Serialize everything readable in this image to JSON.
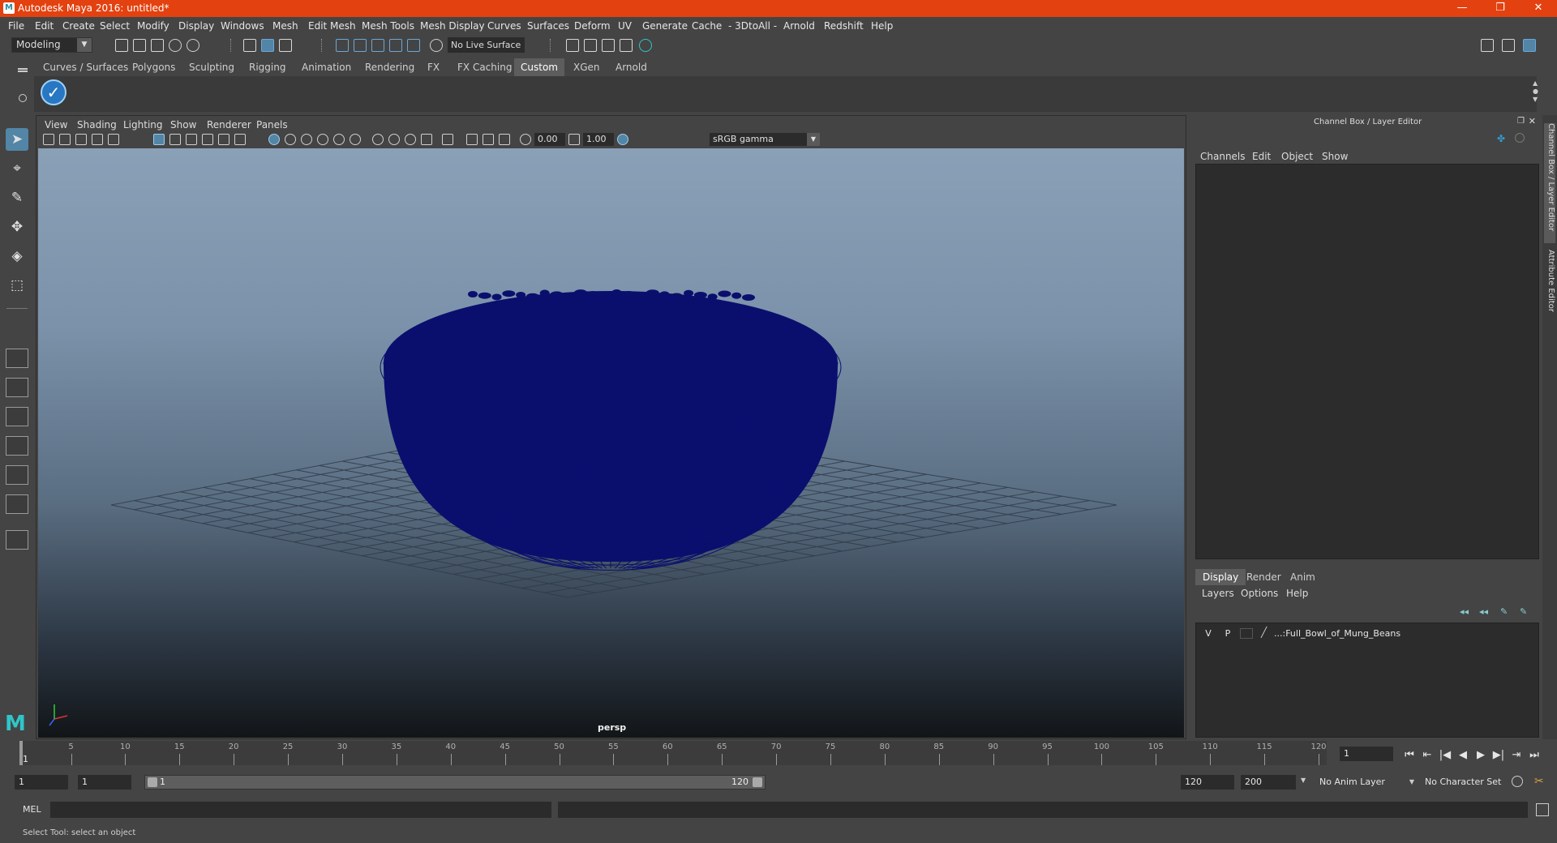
{
  "window": {
    "title": "Autodesk Maya 2016: untitled*",
    "app_icon": "M",
    "minimize": "—",
    "maximize": "❐",
    "close": "✕"
  },
  "menubar": [
    "File",
    "Edit",
    "Create",
    "Select",
    "Modify",
    "Display",
    "Windows",
    "Mesh",
    "Edit Mesh",
    "Mesh Tools",
    "Mesh Display",
    "Curves",
    "Surfaces",
    "Deform",
    "UV",
    "Generate",
    "Cache",
    "- 3DtoAll -",
    "Arnold",
    "Redshift",
    "Help"
  ],
  "statusline": {
    "mode": "Modeling",
    "live_surface": "No Live Surface"
  },
  "shelf": {
    "tabs": [
      "Curves / Surfaces",
      "Polygons",
      "Sculpting",
      "Rigging",
      "Animation",
      "Rendering",
      "FX",
      "FX Caching",
      "Custom",
      "XGen",
      "Arnold"
    ],
    "active_tab": "Custom",
    "button_glyph": "✓"
  },
  "viewport": {
    "menu": [
      "View",
      "Shading",
      "Lighting",
      "Show",
      "Renderer",
      "Panels"
    ],
    "exposure": "0.00",
    "gamma": "1.00",
    "color_space": "sRGB gamma",
    "camera": "persp"
  },
  "channel_box": {
    "title": "Channel Box / Layer Editor",
    "menu": [
      "Channels",
      "Edit",
      "Object",
      "Show"
    ]
  },
  "layer_editor": {
    "tabs": [
      "Display",
      "Render",
      "Anim"
    ],
    "active_tab": "Display",
    "menu": [
      "Layers",
      "Options",
      "Help"
    ],
    "layers": [
      {
        "visible": "V",
        "playback": "P",
        "name": "...:Full_Bowl_of_Mung_Beans"
      }
    ]
  },
  "side_tabs": [
    "Channel Box / Layer Editor",
    "Attribute Editor"
  ],
  "timeslider": {
    "ticks": [
      5,
      10,
      15,
      20,
      25,
      30,
      35,
      40,
      45,
      50,
      55,
      60,
      65,
      70,
      75,
      80,
      85,
      90,
      95,
      100,
      105,
      110,
      115,
      120
    ],
    "current_frame_label": "1",
    "current_frame": "1"
  },
  "playback": [
    "⏮",
    "⇤",
    "|◀",
    "◀",
    "▶",
    "▶|",
    "⇥",
    "⏭"
  ],
  "range": {
    "start": "1",
    "start_inner": "1",
    "range_lo": "1",
    "range_hi": "120",
    "end_inner": "120",
    "end": "200",
    "anim_layer": "No Anim Layer",
    "character_set": "No Character Set"
  },
  "commandline": {
    "label": "MEL",
    "value": ""
  },
  "helpline": "Select Tool: select an object",
  "colors": {
    "title_bar": "#e3410f",
    "selection": "#5285a6",
    "mesh": "#0a0f6e"
  }
}
